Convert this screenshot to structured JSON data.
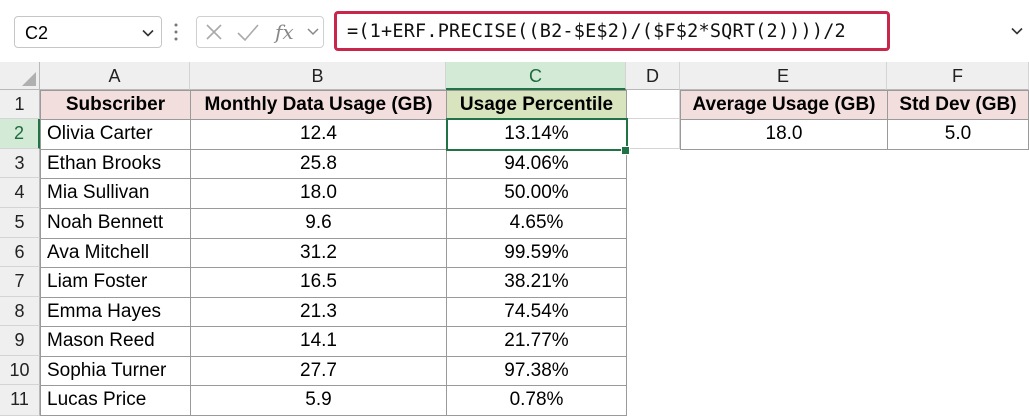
{
  "name_box": {
    "value": "C2"
  },
  "formula_bar": {
    "formula": "=(1+ERF.PRECISE((B2-$E$2)/($F$2*SQRT(2))))/2",
    "fx_label": "fx"
  },
  "columns": [
    "A",
    "B",
    "C",
    "D",
    "E",
    "F"
  ],
  "selected_column": "C",
  "selected_row": "2",
  "rows": [
    "1",
    "2",
    "3",
    "4",
    "5",
    "6",
    "7",
    "8",
    "9",
    "10",
    "11"
  ],
  "table": {
    "headers": [
      "Subscriber",
      "Monthly Data Usage (GB)",
      "Usage Percentile"
    ],
    "rows": [
      [
        "Olivia Carter",
        "12.4",
        "13.14%"
      ],
      [
        "Ethan Brooks",
        "25.8",
        "94.06%"
      ],
      [
        "Mia Sullivan",
        "18.0",
        "50.00%"
      ],
      [
        "Noah Bennett",
        "9.6",
        "4.65%"
      ],
      [
        "Ava Mitchell",
        "31.2",
        "99.59%"
      ],
      [
        "Liam Foster",
        "16.5",
        "38.21%"
      ],
      [
        "Emma Hayes",
        "21.3",
        "74.54%"
      ],
      [
        "Mason Reed",
        "14.1",
        "21.77%"
      ],
      [
        "Sophia Turner",
        "27.7",
        "97.38%"
      ],
      [
        "Lucas Price",
        "5.9",
        "0.78%"
      ]
    ]
  },
  "stats": {
    "headers": [
      "Average Usage (GB)",
      "Std Dev (GB)"
    ],
    "values": [
      "18.0",
      "5.0"
    ]
  },
  "colors": {
    "accent_green": "#217346",
    "formula_border": "#c8264a",
    "header_pink": "#f3dede",
    "header_green": "#d7e4bd"
  }
}
